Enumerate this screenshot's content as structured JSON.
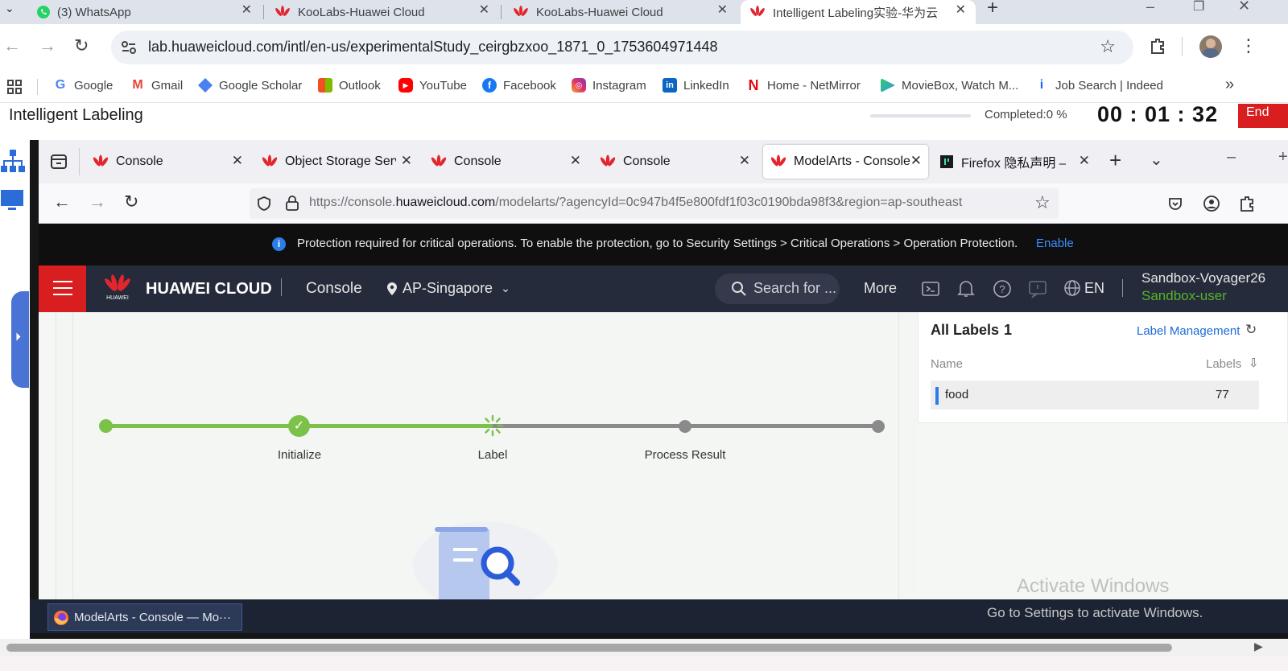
{
  "chrome": {
    "tabs": [
      {
        "title": "(3) WhatsApp"
      },
      {
        "title": "KooLabs-Huawei Cloud"
      },
      {
        "title": "KooLabs-Huawei Cloud"
      },
      {
        "title": "Intelligent Labeling实验-华为云",
        "active": true
      }
    ],
    "url": "lab.huaweicloud.com/intl/en-us/experimentalStudy_ceirgbzxoo_1871_0_1753604971448",
    "bookmarks": [
      "Google",
      "Gmail",
      "Google Scholar",
      "Outlook",
      "YouTube",
      "Facebook",
      "Instagram",
      "LinkedIn",
      "Home - NetMirror",
      "MovieBox, Watch M...",
      "Job Search | Indeed"
    ],
    "more_bookmarks": "»"
  },
  "lab": {
    "title": "Intelligent Labeling",
    "completed": "Completed:0 %",
    "timer": "00 : 01 : 32",
    "end_button": "End"
  },
  "firefox": {
    "tabs": [
      {
        "title": "Console"
      },
      {
        "title": "Object Storage Serv"
      },
      {
        "title": "Console"
      },
      {
        "title": "Console"
      },
      {
        "title": "ModelArts - Console",
        "active": true
      },
      {
        "title": "Firefox 隐私声明 —"
      }
    ],
    "url_prefix": "https://console.",
    "url_domain": "huaweicloud.com",
    "url_rest": "/modelarts/?agencyId=0c947b4f5e800fdf1f03c0190bda98f3&region=ap-southeast"
  },
  "notice": {
    "text": "Protection required for critical operations. To enable the protection, go to Security Settings > Critical Operations > Operation Protection.",
    "link": "Enable"
  },
  "hwnav": {
    "brand": "HUAWEI CLOUD",
    "logo_text": "HUAWEI",
    "console": "Console",
    "region": "AP-Singapore",
    "search_placeholder": "Search for ...",
    "more": "More",
    "lang": "EN",
    "user": "Sandbox-Voyager26",
    "role": "Sandbox-user"
  },
  "steps": [
    {
      "label": "Initialize"
    },
    {
      "label": "Label"
    },
    {
      "label": "Process Result"
    }
  ],
  "labels_panel": {
    "title": "All Labels",
    "count": "1",
    "manage": "Label Management",
    "col_name": "Name",
    "col_labels": "Labels",
    "rows": [
      {
        "name": "food",
        "count": "77"
      }
    ]
  },
  "taskbar": {
    "app": "ModelArts - Console — Mo···"
  },
  "watermark": {
    "line1": "Activate Windows",
    "line2": "Go to Settings to activate Windows."
  },
  "colors": {
    "huawei_red": "#d81e1e",
    "progress_green": "#7cc24a",
    "link_blue": "#1e6ad9",
    "sandbox_green": "#54b32c"
  }
}
